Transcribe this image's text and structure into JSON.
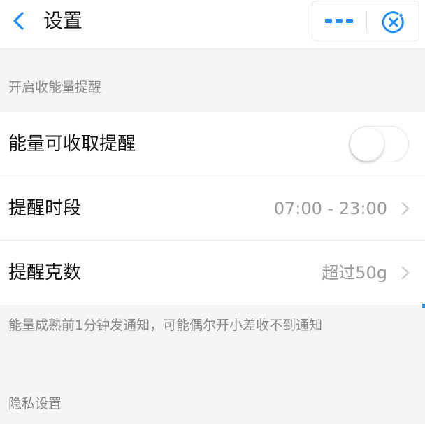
{
  "header": {
    "title": "设置",
    "back_icon": "chevron-left-icon",
    "more_icon": "more-dots-icon",
    "close_icon": "close-circle-icon",
    "accent_color": "#1a8cff"
  },
  "sections": {
    "reminder_header": "开启收能量提醒",
    "privacy_header": "隐私设置"
  },
  "rows": {
    "energy_reminder": {
      "label": "能量可收取提醒",
      "toggle_on": false
    },
    "reminder_period": {
      "label": "提醒时段",
      "value": "07:00 - 23:00"
    },
    "reminder_grams": {
      "label": "提醒克数",
      "value": "超过50g"
    }
  },
  "note": "能量成熟前1分钟发通知，可能偶尔开小差收不到通知"
}
